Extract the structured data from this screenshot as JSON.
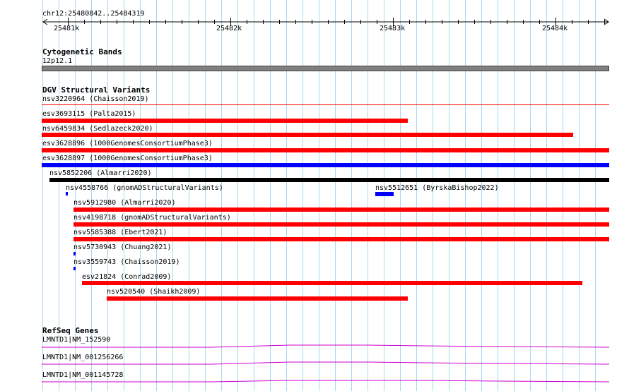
{
  "ruler": {
    "location": "chr12:25480842..25484319",
    "ticks": [
      "25481k",
      "25482k",
      "25483k",
      "25484k"
    ]
  },
  "tracks": {
    "cytoband": {
      "title": "Cytogenetic Bands",
      "band_label": "12p12.1",
      "band_color": "#808080"
    },
    "dgv": {
      "title": "DGV Structural Variants",
      "features": [
        {
          "label": "nsv3220964 (Chaisson2019)",
          "color": "#ff0000"
        },
        {
          "label": "esv3693115 (Palta2015)",
          "color": "#ff0000"
        },
        {
          "label": "nsv6459834 (Sedlazeck2020)",
          "color": "#ff0000"
        },
        {
          "label": "esv3628896 (1000GenomesConsortiumPhase3)",
          "color": "#ff0000"
        },
        {
          "label": "esv3628897 (1000GenomesConsortiumPhase3)",
          "color": "#0000ff"
        },
        {
          "label": "nsv5852206 (Almarri2020)",
          "color": "#000000"
        },
        {
          "label": "nsv4558766 (gnomADStructuralVariants)",
          "color": "#0000ff"
        },
        {
          "label": "nsv5512651 (ByrskaBishop2022)",
          "color": "#0000ff"
        },
        {
          "label": "nsv5912980 (Almarri2020)",
          "color": "#ff0000"
        },
        {
          "label": "nsv4198718 (gnomADStructuralVariants)",
          "color": "#ff0000"
        },
        {
          "label": "nsv5585388 (Ebert2021)",
          "color": "#ff0000"
        },
        {
          "label": "nsv5730943 (Chuang2021)",
          "color": "#0000ff"
        },
        {
          "label": "nsv3559743 (Chaisson2019)",
          "color": "#0000ff"
        },
        {
          "label": "esv21824 (Conrad2009)",
          "color": "#ff0000"
        },
        {
          "label": "nsv520540 (Shaikh2009)",
          "color": "#ff0000"
        }
      ]
    },
    "refseq": {
      "title": "RefSeq Genes",
      "color": "#cc00cc",
      "genes": [
        {
          "label": "LMNTD1|NM_152590"
        },
        {
          "label": "LMNTD1|NM_001256266"
        },
        {
          "label": "LMNTD1|NM_001145728"
        }
      ]
    }
  },
  "colors": {
    "grid_line": "#a8d8ec",
    "ruler_line": "#000000",
    "text": "#000000"
  }
}
